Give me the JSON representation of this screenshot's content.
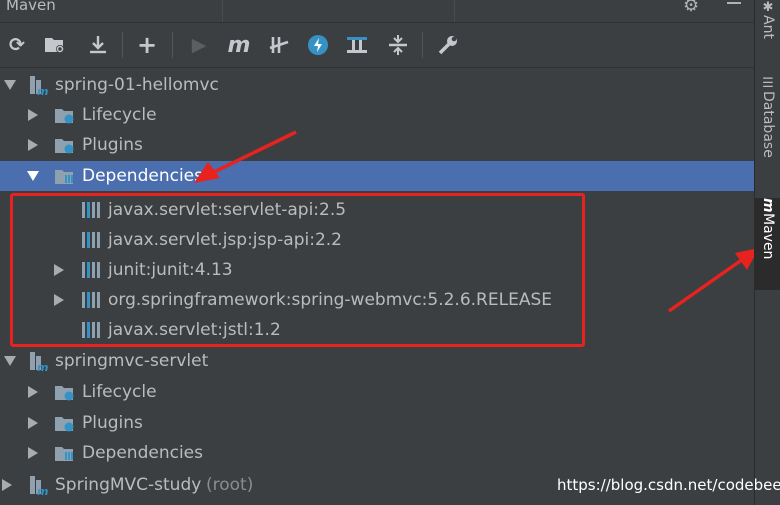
{
  "panel": {
    "title": "Maven"
  },
  "toolbar": {
    "reload": "reload-icon",
    "reimport": "reimport-icon",
    "download": "download-icon",
    "add": "add-icon",
    "run": "run-icon",
    "maven_goal": "m",
    "skip_tests": "skip-tests-icon",
    "offline": "offline-icon",
    "show_deps": "show-dependencies-icon",
    "collapse": "collapse-icon",
    "settings": "wrench-icon"
  },
  "tree": {
    "project1": {
      "name": "spring-01-hellomvc",
      "lifecycle": "Lifecycle",
      "plugins": "Plugins",
      "dependencies": "Dependencies",
      "deps": [
        "javax.servlet:servlet-api:2.5",
        "javax.servlet.jsp:jsp-api:2.2",
        "junit:junit:4.13",
        "org.springframework:spring-webmvc:5.2.6.RELEASE",
        "javax.servlet:jstl:1.2"
      ]
    },
    "project2": {
      "name": "springmvc-servlet",
      "lifecycle": "Lifecycle",
      "plugins": "Plugins",
      "dependencies": "Dependencies"
    },
    "project3": {
      "name": "SpringMVC-study",
      "suffix": "(root)"
    }
  },
  "sidebar": {
    "ant": "Ant",
    "database": "Database",
    "maven": "Maven"
  },
  "watermark": "https://blog.csdn.net/codebeef",
  "colors": {
    "selection": "#4b6eaf",
    "annotation": "#e8221e",
    "background": "#3c3f41"
  }
}
